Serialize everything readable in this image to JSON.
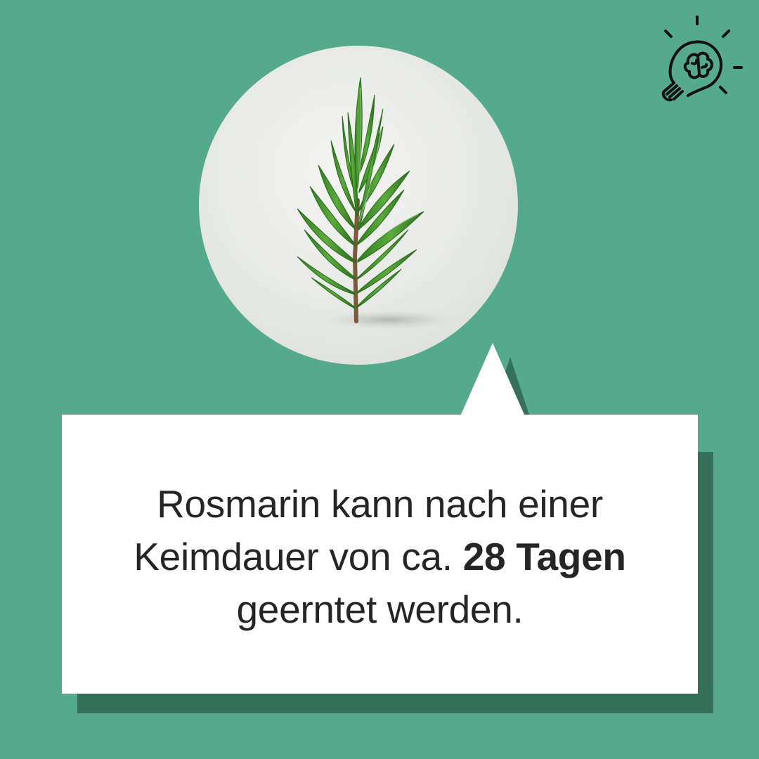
{
  "colors": {
    "background": "#55aa8e",
    "bubble": "#ffffff",
    "bubble_shadow": "#35705b",
    "text": "#252525"
  },
  "icons": {
    "top_right": "lightbulb-brain-icon",
    "illustration": "rosemary-sprig"
  },
  "message": {
    "line1": "Rosmarin kann nach einer",
    "line2_start": "Keimdauer von ca.",
    "line2_highlight": "28 Tagen",
    "line3": "geerntet werden."
  }
}
